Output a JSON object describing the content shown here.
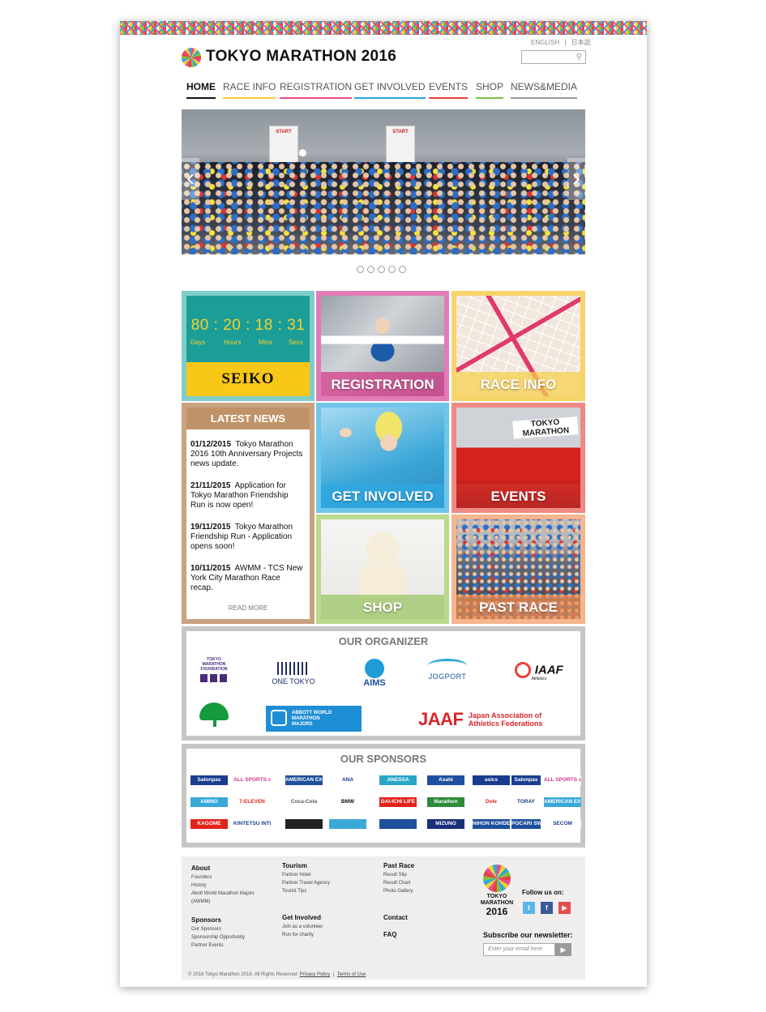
{
  "header": {
    "lang_en": "ENGLISH",
    "lang_sep": "|",
    "lang_jp": "日本語",
    "search_placeholder": "",
    "logo_text": "TOKYO MARATHON 2016"
  },
  "nav": [
    {
      "label": "HOME",
      "color": "#111111",
      "active": true
    },
    {
      "label": "RACE INFO",
      "color": "#f6d02e"
    },
    {
      "label": "REGISTRATION",
      "color": "#e84c8b"
    },
    {
      "label": "GET INVOLVED",
      "color": "#2fa8e0"
    },
    {
      "label": "EVENTS",
      "color": "#e9423b"
    },
    {
      "label": "SHOP",
      "color": "#7cc242"
    },
    {
      "label": "NEWS&MEDIA",
      "color": "#999999"
    }
  ],
  "hero": {
    "prev": "‹",
    "next": "›",
    "signs": [
      "START",
      "START"
    ],
    "slide_count": 5,
    "active_slide": 1
  },
  "countdown": {
    "days": "80",
    "hours": "20",
    "mins": "18",
    "secs": "31",
    "sep": ":",
    "units": [
      "Days",
      "Hours",
      "Mins",
      "Secs"
    ],
    "sponsor": "SEIKO"
  },
  "tiles": {
    "registration": "REGISTRATION",
    "race_info": "RACE INFO",
    "get_involved": "GET INVOLVED",
    "events": "EVENTS",
    "shop": "SHOP",
    "past_race": "PAST RACE"
  },
  "news": {
    "title": "LATEST NEWS",
    "items": [
      {
        "date": "01/12/2015",
        "text": "Tokyo Marathon 2016 10th Anniversary Projects news update."
      },
      {
        "date": "21/11/2015",
        "text": "Application for Tokyo Marathon Friendship Run is now open!"
      },
      {
        "date": "19/11/2015",
        "text": "Tokyo Marathon Friendship Run - Application opens soon!"
      },
      {
        "date": "10/11/2015",
        "text": "AWMM - TCS New York City Marathon Race recap."
      }
    ],
    "read_more": "READ MORE"
  },
  "organizer": {
    "title": "OUR ORGANIZER",
    "logos": {
      "foundation": "TOKYO MARATHON FOUNDATION",
      "one_tokyo": "ONE TOKYO",
      "aims": "AIMS",
      "jogport": "JOGPORT",
      "iaaf": "IAAF",
      "iaaf_sub": "Athletics",
      "abbott": "ABBOTT WORLD MARATHON MAJORS",
      "jaaf": "JAAF",
      "jaaf_full1": "Japan Association of",
      "jaaf_full2": "Athletics Federations"
    }
  },
  "sponsors": {
    "title": "OUR SPONSORS",
    "rows": [
      [
        {
          "name": "Salonpas",
          "bg": "#1a3d8f",
          "fg": "#fff"
        },
        {
          "name": "ALL SPORTS community",
          "bg": "#fff",
          "fg": "#d2338c"
        },
        {
          "name": "AMERICAN EXPRESS",
          "bg": "#1d4f9c",
          "fg": "#fff"
        },
        {
          "name": "ANA",
          "bg": "#fff",
          "fg": "#133b8f"
        },
        {
          "name": "ANESSA",
          "bg": "#2aa6c9",
          "fg": "#fff"
        },
        {
          "name": "Asahi",
          "bg": "#1f4fa0",
          "fg": "#fff"
        },
        {
          "name": "asics",
          "bg": "#173a8c",
          "fg": "#fff"
        },
        {
          "name": "Salonpas",
          "bg": "#1a3d8f",
          "fg": "#fff"
        },
        {
          "name": "ALL SPORTS community",
          "bg": "#fff",
          "fg": "#d2338c"
        }
      ],
      [
        {
          "name": "AMINO",
          "bg": "#3ba9d8",
          "fg": "#fff"
        },
        {
          "name": "7-ELEVEN",
          "bg": "#fff",
          "fg": "#e2231a"
        },
        {
          "name": "Coca-Cola",
          "bg": "#fff",
          "fg": "#555"
        },
        {
          "name": "BMW",
          "bg": "#fff",
          "fg": "#111"
        },
        {
          "name": "DAI-ICHI LIFE",
          "bg": "#e2231a",
          "fg": "#fff"
        },
        {
          "name": "Marathon",
          "bg": "#2f8a3a",
          "fg": "#fff"
        },
        {
          "name": "Dole",
          "bg": "#fff",
          "fg": "#e2231a"
        },
        {
          "name": "TORAY",
          "bg": "#fff",
          "fg": "#1a3d8f"
        },
        {
          "name": "AMERICAN EXPRESS",
          "bg": "#3ba9d8",
          "fg": "#fff"
        }
      ],
      [
        {
          "name": "KAGOME",
          "bg": "#e2231a",
          "fg": "#fff"
        },
        {
          "name": "KINTETSU INTERNATIONAL",
          "bg": "#fff",
          "fg": "#1a3d8f"
        },
        {
          "name": "",
          "bg": "#222",
          "fg": "#fff"
        },
        {
          "name": "",
          "bg": "#3ba9d8",
          "fg": "#fff"
        },
        {
          "name": "",
          "bg": "#1d4f9c",
          "fg": "#fff"
        },
        {
          "name": "MIZUNO",
          "bg": "#1a2f7a",
          "fg": "#fff"
        },
        {
          "name": "NIHON KOHDEN",
          "bg": "#1d4f9c",
          "fg": "#fff"
        },
        {
          "name": "POCARI SWEAT",
          "bg": "#1d4f9c",
          "fg": "#fff"
        },
        {
          "name": "SECOM",
          "bg": "#fff",
          "fg": "#1a3d8f"
        }
      ]
    ]
  },
  "footer": {
    "col1": {
      "heading": "About",
      "links": [
        "Founders",
        "History",
        "Abott World Marathon Majors",
        "(AWMM)"
      ],
      "heading2": "Sponsors",
      "links2": [
        "Our Sponsors",
        "Sponsorship Opportunity",
        "Partner Events"
      ]
    },
    "col2": {
      "heading": "Tourism",
      "links": [
        "Partner Hotel",
        "Partner Travel Agency",
        "Tourist Tips"
      ],
      "heading2": "Get Involved",
      "links2": [
        "Join as a volunteer",
        "Run for charity"
      ]
    },
    "col3": {
      "heading": "Past Race",
      "links": [
        "Result Slip",
        "Result Chart",
        "Photo Gallery"
      ],
      "heading2": "Contact",
      "heading3": "FAQ"
    },
    "logo_line1": "TOKYO",
    "logo_line2": "MARATHON",
    "logo_line3": "2016",
    "follow": "Follow us on:",
    "social": [
      {
        "name": "twitter",
        "glyph": "t",
        "color": "#5bb6e8"
      },
      {
        "name": "facebook",
        "glyph": "f",
        "color": "#3b5a9a"
      },
      {
        "name": "youtube",
        "glyph": "▶",
        "color": "#e74c4c"
      }
    ],
    "newsletter": "Subscribe our newsletter:",
    "email_placeholder": "Enter your email here",
    "submit": "▶",
    "copyright": "© 2016 Tokyo Marathon 2016. All Rights Reserved.",
    "privacy": "Privacy Policy",
    "sep": "|",
    "terms": "Terms of Use"
  }
}
